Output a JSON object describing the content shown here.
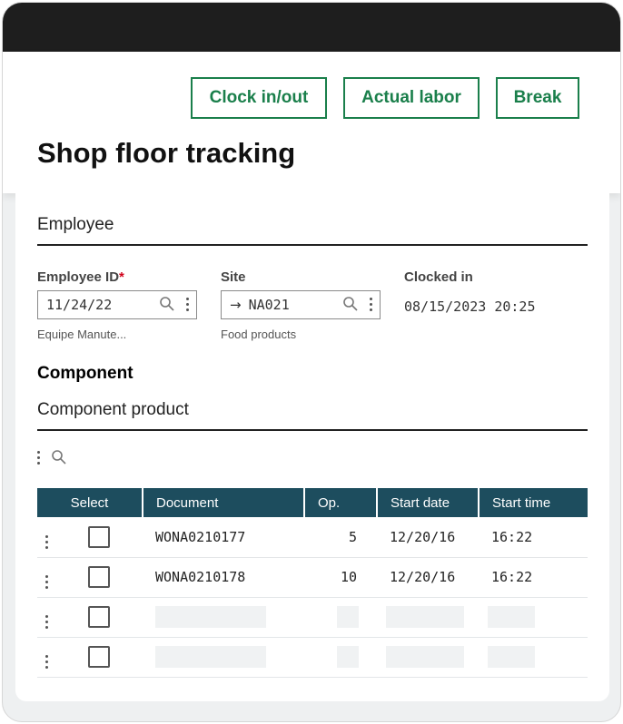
{
  "header": {
    "buttons": {
      "clock": "Clock in/out",
      "labor": "Actual labor",
      "break": "Break"
    },
    "title": "Shop floor tracking"
  },
  "employee_section": {
    "title": "Employee",
    "employee_id": {
      "label": "Employee ID",
      "required_mark": "*",
      "value": "11/24/22",
      "helper": "Equipe Manute..."
    },
    "site": {
      "label": "Site",
      "arrow": "→",
      "value": "NA021",
      "helper": "Food products"
    },
    "clocked_in": {
      "label": "Clocked in",
      "value": "08/15/2023 20:25"
    }
  },
  "component_section": {
    "heading": "Component",
    "subtitle": "Component product"
  },
  "table": {
    "columns": [
      "Select",
      "Document",
      "Op.",
      "Start date",
      "Start time"
    ],
    "rows": [
      {
        "document": "WONA0210177",
        "op": "5",
        "start_date": "12/20/16",
        "start_time": "16:22"
      },
      {
        "document": "WONA0210178",
        "op": "10",
        "start_date": "12/20/16",
        "start_time": "16:22"
      }
    ]
  },
  "colors": {
    "accent_green": "#1a7f4b",
    "table_header": "#1d4d5e",
    "required_red": "#d0021b"
  },
  "icons": [
    "search-icon",
    "kebab-menu-icon",
    "arrow-right-icon"
  ]
}
